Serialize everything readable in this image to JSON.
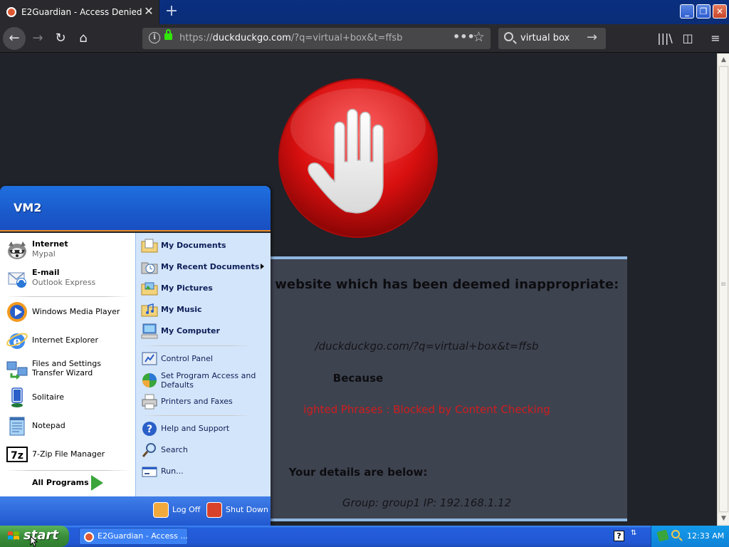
{
  "browser": {
    "tab_title": "E2Guardian - Access Denied",
    "tab_close": "✕",
    "new_tab": "+",
    "url_host_prefix": "https://",
    "url_host": "duckduckgo.com",
    "url_path": "/?q=virtual+box&t=ffsb",
    "search_query": "virtual box"
  },
  "page": {
    "headline": "ing a website which has been deemed inappropriate:",
    "blocked_url": "/duckduckgo.com/?q=virtual+box&t=ffsb",
    "because_label": "Because",
    "reason": "ighted Phrases : Blocked by Content Checking",
    "details_heading": "Your details are below:",
    "details": "Group: group1   IP: 192.168.1.12"
  },
  "start_menu": {
    "user_name": "VM2",
    "pinned": [
      {
        "title": "Internet",
        "subtitle": "Mypal",
        "icon": "mypal-raccoon-icon"
      },
      {
        "title": "E-mail",
        "subtitle": "Outlook Express",
        "icon": "outlook-express-icon"
      }
    ],
    "recent": [
      {
        "label": "Windows Media Player",
        "icon": "windows-media-player-icon"
      },
      {
        "label": "Internet Explorer",
        "icon": "internet-explorer-icon"
      },
      {
        "label": "Files and Settings Transfer Wizard",
        "icon": "transfer-wizard-icon"
      },
      {
        "label": "Solitaire",
        "icon": "solitaire-icon"
      },
      {
        "label": "Notepad",
        "icon": "notepad-icon"
      },
      {
        "label": "7-Zip File Manager",
        "icon": "7zip-icon"
      }
    ],
    "all_programs": "All Programs",
    "places": [
      {
        "label": "My Documents",
        "icon": "folder-documents-icon"
      },
      {
        "label": "My Recent Documents",
        "icon": "recent-documents-icon"
      },
      {
        "label": "My Pictures",
        "icon": "folder-pictures-icon"
      },
      {
        "label": "My Music",
        "icon": "folder-music-icon"
      },
      {
        "label": "My Computer",
        "icon": "my-computer-icon"
      }
    ],
    "settings": [
      {
        "label": "Control Panel",
        "icon": "control-panel-icon"
      },
      {
        "label": "Set Program Access and Defaults",
        "icon": "program-defaults-icon"
      },
      {
        "label": "Printers and Faxes",
        "icon": "printer-icon"
      }
    ],
    "tools": [
      {
        "label": "Help and Support",
        "icon": "help-icon"
      },
      {
        "label": "Search",
        "icon": "search-icon"
      },
      {
        "label": "Run...",
        "icon": "run-icon"
      }
    ],
    "log_off": "Log Off",
    "shut_down": "Shut Down"
  },
  "taskbar": {
    "start_label": "start",
    "task_label": "E2Guardian - Access ...",
    "help_glyph": "?",
    "clock": "12:33 AM"
  },
  "colors": {
    "taskbar_blue": "#245edc",
    "start_green": "#3a8e3a",
    "reason_red": "#d11d1d",
    "page_bg": "#20232a"
  }
}
